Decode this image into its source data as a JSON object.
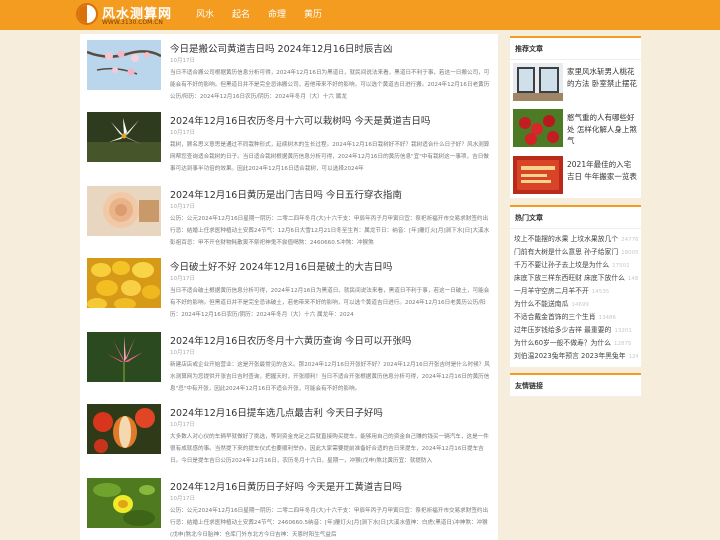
{
  "header": {
    "logo_text": "风水测算网",
    "logo_url": "WWW.3130.COM.CN",
    "nav": [
      {
        "label": "风水"
      },
      {
        "label": "起名"
      },
      {
        "label": "命理"
      },
      {
        "label": "黄历"
      }
    ]
  },
  "articles": [
    {
      "title": "今日是搬公司黄道吉日吗 2024年12月16日时辰吉凶",
      "date": "10月17日",
      "desc": "当日不适合搬公司根据黄历信息分析可得，2024年12月16日为黑道日，就民间说法来看，黑道日不利于事，若这一日搬公司，可能会有不好的影响。但黑道日并不是完全忌讳搬公司，若他带来不好的影响，可以选个黄道吉日进行搬。2024年12月16日老黄历公历/阳历：2024年12月16日农历/阴历：2024年冬月（大）十六 属龙"
    },
    {
      "title": "2024年12月16日农历冬月十六可以栽树吗 今天是黄道吉日吗",
      "date": "10月17日",
      "desc": "栽树，顾名思义意思是通过不同栽种形式，延续树木的生长过程。2024年12月16日栽树好不好？栽树适合什么日子好？风水测算网帮您查询适合栽树的日子。当日适合栽树根据黄历信息分析可得，2024年12月16日的黄历信息\"宜\"中有栽树这一事项，吉日做事可达到事半功倍的效果。因此2024年12月16日适合栽树，可以选择2024年"
    },
    {
      "title": "2024年12月16日黄历是出门吉日吗 今日五行穿衣指南",
      "date": "10月17日",
      "desc": "公历：公元2024年12月16日星期一阴历：二零二四年冬月(大)十六干支：甲辰年丙子月甲寅日宜：祭祀祈福开市交易求财签约出行忌：结婚上任求医种植动土安葬24节气：12月6日大雪12月21日冬至生肖：属龙节日：纳音：[年]覆灯火[月]涧下水[日]大溪水彭祖百忌：甲不开仓财物耗散寅不祭祀神鬼不尝值喝煞：2460660.5冲煞：冲猴煞"
    },
    {
      "title": "今日破土好不好 2024年12月16日是破土的大吉日吗",
      "date": "10月17日",
      "desc": "当日不适合破土根据黄历信息分析可得，2024年12月16日为黑道日，就民间说法来看，黑道日不利于事，若这一日破土，可能会有不好的影响。但黑道日并不是完全忌讳破土，若他带来不好的影响，可以选个黄道吉日进行。2024年12月16日老黄历公历/阳历：2024年12月16日农历/阴历：2024年冬月（大）十六 属龙年：2024"
    },
    {
      "title": "2024年12月16日农历冬月十六黄历查询 今日可以开张吗",
      "date": "10月17日",
      "desc": "新建店店或企业开始营业：这是开张最常见的含义。那2024年12月16日开张好不好？2024年12月16日开张吉时是什么时候？风水测算网为您提供开张吉日吉时查询，把握天时，开张顺利！当日不适合开张根据黄历信息分析可得，2024年12月16日的黄历信息\"忌\"中有开张，因此2024年12月16日不适合开张，可能会有不好的影响。"
    },
    {
      "title": "2024年12月16日提车选几点最吉利 今天日子好吗",
      "date": "10月17日",
      "desc": "大多数人对心仪的车辆早就做好了挑选，等到资金充足之后就直接购买提车，能够用自己的资金自己赚的钱买一辆汽车，这是一件很有成就感的事。当然提下来的提车仪式也要顺利举办，因此大家需要提前准备好合适的吉日来提车，2024年12月16日提车吉日。今日是提车吉日公历2024年12月16日，农历冬月十六日，星期一，冲猴(戊申)煞北黄历宜：就提防入"
    },
    {
      "title": "2024年12月16日黄历日子好吗 今天是开工黄道吉日吗",
      "date": "10月17日",
      "desc": "公历：公元2024年12月16日星期一阴历：二零二四年冬月(大)十六干支：甲辰年丙子月甲寅日宜：祭祀祈福开市交易求财签约出行忌：结婚上任求医种植动土安葬24节气：2460660.5纳音：[年]覆灯火[月]涧下水[日]大溪水值神：白虎(黑道日)冲神煞：冲猴(戊申)煞北今日胎神：仓库门外东北方今日吉神：天恩时阳生气益后"
    }
  ],
  "sidebar": {
    "recommend_title": "推荐文章",
    "recommend": [
      {
        "title": "家里风水斩男人桃花的方法 卧室禁止摆花"
      },
      {
        "title": "憨气重的人有哪些好处 怎样化解人身上煞气"
      },
      {
        "title": "2021年最佳的入宅吉日 牛年搬家一览表"
      }
    ],
    "hot_title": "热门文章",
    "hot": [
      {
        "title": "坟上不能摆的水果 上坟水果放几个",
        "count": "24776"
      },
      {
        "title": "门前有大树是什么意思 孙子给家门",
        "count": "18005"
      },
      {
        "title": "千万不要让孙子去上坟是为什么",
        "count": "17501"
      },
      {
        "title": "床底下放三样东西旺财 床底下放什么",
        "count": "14895"
      },
      {
        "title": "一月羊守空房二月羊不开",
        "count": "14535"
      },
      {
        "title": "为什么不能送南瓜",
        "count": "14699"
      },
      {
        "title": "不适合戴金首饰的三个生肖",
        "count": "13486"
      },
      {
        "title": "过年压岁钱给多少吉祥 最重要的",
        "count": "13201"
      },
      {
        "title": "为什么60岁一般不做寿？为什么",
        "count": "12875"
      },
      {
        "title": "刘伯温2023兔年预言 2023年黑兔年",
        "count": "12439"
      }
    ],
    "links_title": "友情链接"
  },
  "colors": {
    "accent": "#f39c1f",
    "background": "#f6eddd"
  }
}
